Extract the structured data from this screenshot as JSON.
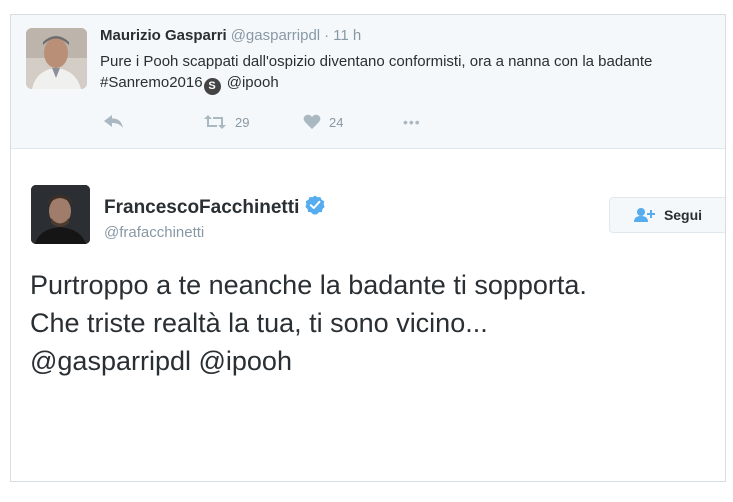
{
  "parent_tweet": {
    "author_name": "Maurizio Gasparri",
    "author_handle": "@gasparripdl",
    "separator": "·",
    "time": "11 h",
    "text_part1": "Pure i Pooh scappati dall'ospizio diventano conformisti, ora a nanna con la badante #Sanremo2016",
    "badge_letter": "S",
    "text_part2": " @ipooh",
    "retweet_count": "29",
    "like_count": "24",
    "more_label": "•••"
  },
  "main_tweet": {
    "author_name": "FrancescoFacchinetti",
    "author_handle": "@frafacchinetti",
    "follow_label": "Segui",
    "text_lines": [
      "Purtroppo a te neanche la badante ti sopporta.",
      "Che triste realtà la tua, ti sono vicino...",
      "@gasparripdl @ipooh"
    ]
  },
  "colors": {
    "verified": "#55acee",
    "follow_icon": "#55acee",
    "icon_gray": "#aab8c2"
  }
}
